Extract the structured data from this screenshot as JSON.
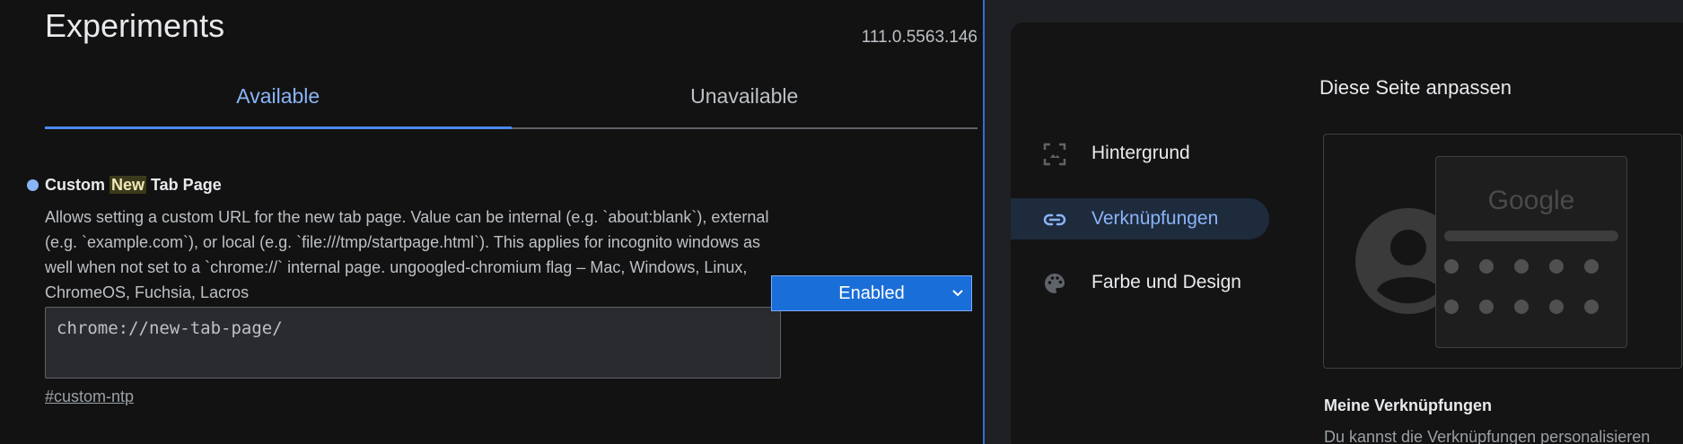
{
  "flags": {
    "title": "Experiments",
    "version": "111.0.5563.146",
    "tabs": [
      {
        "label": "Available",
        "active": true
      },
      {
        "label": "Unavailable",
        "active": false
      }
    ],
    "experiment": {
      "title_before": "Custom ",
      "title_highlight": "New",
      "title_after": " Tab Page",
      "description": "Allows setting a custom URL for the new tab page. Value can be internal (e.g. `about:blank`), external (e.g. `example.com`), or local (e.g. `file:///tmp/startpage.html`). This applies for incognito windows as well when not set to a `chrome://` internal page. ungoogled-chromium flag – Mac, Windows, Linux, ChromeOS, Fuchsia, Lacros",
      "input_value": "chrome://new-tab-page/",
      "anchor": "#custom-ntp",
      "select_value": "Enabled"
    }
  },
  "customize": {
    "title": "Diese Seite anpassen",
    "nav": [
      {
        "label": "Hintergrund",
        "icon": "background-icon",
        "active": false
      },
      {
        "label": "Verknüpfungen",
        "icon": "link-icon",
        "active": true
      },
      {
        "label": "Farbe und Design",
        "icon": "palette-icon",
        "active": false
      }
    ],
    "preview": {
      "logo": "Google"
    },
    "section_title": "Meine Verknüpfungen",
    "section_text": "Du kannst die Verknüpfungen personalisieren"
  },
  "colors": {
    "accent": "#8ab4f8",
    "select_bg": "#1a6ed8",
    "divider": "#2f6fd2"
  }
}
